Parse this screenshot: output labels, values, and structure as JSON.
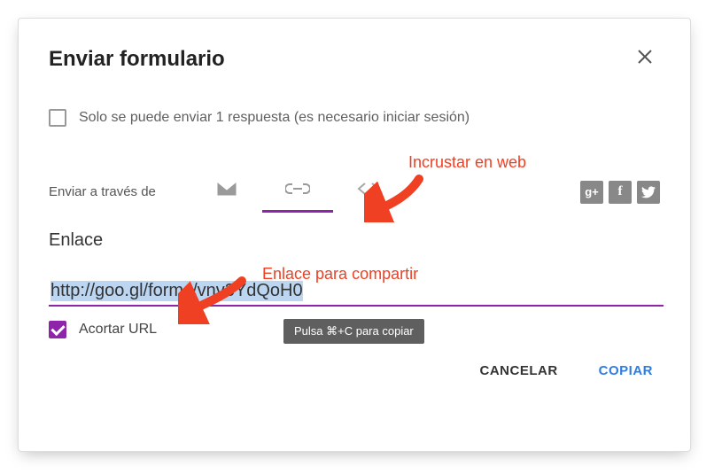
{
  "dialog": {
    "title": "Enviar formulario",
    "one_response_label": "Solo se puede enviar 1 respuesta (es necesario iniciar sesión)",
    "send_via_label": "Enviar a través de",
    "link_section_label": "Enlace",
    "link_value": "http://goo.gl/forms/vnv3YdQoH0",
    "shorten_url_label": "Acortar URL",
    "copy_tooltip": "Pulsa ⌘+C para copiar",
    "cancel_label": "CANCELAR",
    "copy_label": "COPIAR"
  },
  "tabs": {
    "email": "email",
    "link": "link",
    "embed": "embed",
    "active": "link"
  },
  "share": {
    "gplus": "Google+",
    "facebook": "Facebook",
    "twitter": "Twitter"
  },
  "annotations": {
    "embed": "Incrustar en web",
    "share_link": "Enlace para compartir"
  },
  "colors": {
    "accent": "#8e24aa",
    "annotation": "#ef4023",
    "copy_blue": "#2f7de1"
  }
}
